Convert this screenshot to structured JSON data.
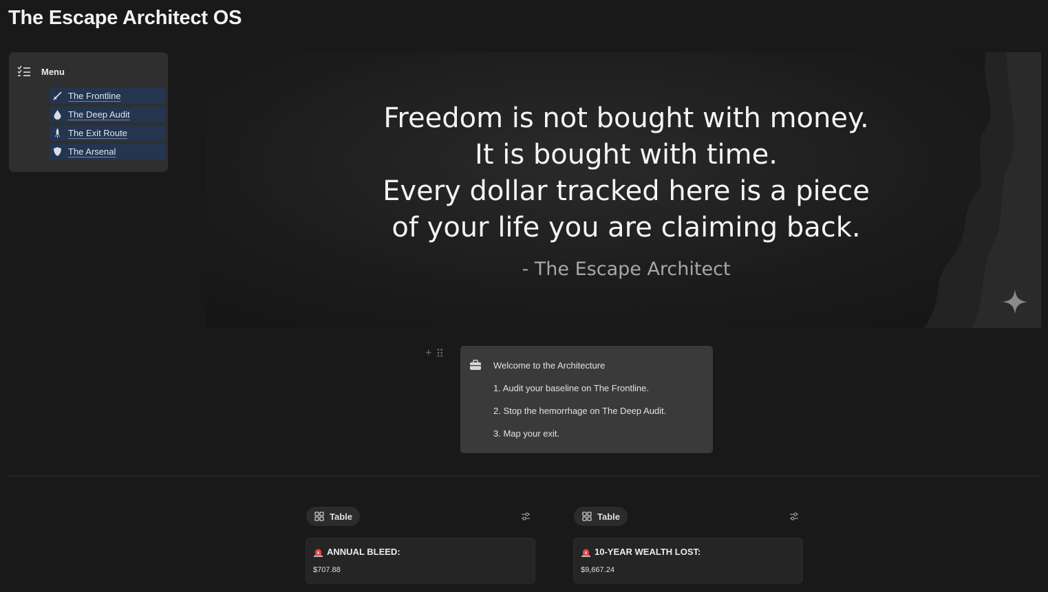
{
  "page": {
    "title": "The Escape Architect OS"
  },
  "menu": {
    "label": "Menu",
    "items": [
      {
        "label": "The Frontline",
        "icon": "sword-icon"
      },
      {
        "label": "The Deep Audit",
        "icon": "drop-icon"
      },
      {
        "label": "The Exit Route",
        "icon": "rocket-icon"
      },
      {
        "label": "The Arsenal",
        "icon": "shield-icon"
      }
    ]
  },
  "banner": {
    "quote_lines": [
      "Freedom is not bought with money.",
      "It is bought with time.",
      "Every dollar tracked here is a piece",
      "of your life you are claiming back."
    ],
    "attribution": "- The Escape Architect"
  },
  "callout": {
    "icon": "briefcase-icon",
    "title": "Welcome to the Architecture",
    "steps": [
      "1. Audit your baseline on The Frontline.",
      "2. Stop the hemorrhage on The Deep Audit.",
      "3. Map your exit."
    ]
  },
  "views": [
    {
      "tab_label": "Table",
      "card_title": "ANNUAL BLEED:",
      "card_value": "$707.88",
      "icon": "siren-icon"
    },
    {
      "tab_label": "Table",
      "card_title": "10-YEAR WEALTH LOST:",
      "card_value": "$9,667.24",
      "icon": "siren-icon"
    }
  ],
  "colors": {
    "background": "#191919",
    "menu_item_bg": "#243550",
    "card_bg": "#2f2f2f",
    "callout_bg": "#3a3a3a"
  }
}
